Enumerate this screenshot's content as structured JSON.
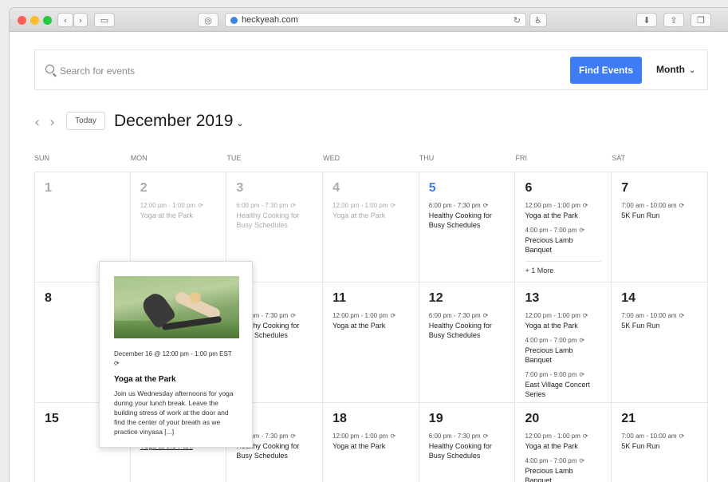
{
  "browser": {
    "url": "heckyeah.com"
  },
  "search": {
    "placeholder": "Search for events",
    "find_label": "Find Events",
    "view_label": "Month"
  },
  "nav": {
    "today_label": "Today",
    "month_label": "December 2019"
  },
  "weekdays": [
    "SUN",
    "MON",
    "TUE",
    "WED",
    "THU",
    "FRI",
    "SAT"
  ],
  "weeks": [
    [
      {
        "day": "1",
        "past": true,
        "events": []
      },
      {
        "day": "2",
        "past": true,
        "events": [
          {
            "time": "12:00 pm - 1:00 pm",
            "title": "Yoga at the Park",
            "past": true
          }
        ]
      },
      {
        "day": "3",
        "past": true,
        "events": [
          {
            "time": "6:00 pm - 7:30 pm",
            "title": "Healthy Cooking for Busy Schedules",
            "past": true
          }
        ]
      },
      {
        "day": "4",
        "past": true,
        "events": [
          {
            "time": "12:00 pm - 1:00 pm",
            "title": "Yoga at the Park",
            "past": true
          }
        ]
      },
      {
        "day": "5",
        "today": true,
        "events": [
          {
            "time": "6:00 pm - 7:30 pm",
            "title": "Healthy Cooking for Busy Schedules"
          }
        ]
      },
      {
        "day": "6",
        "events": [
          {
            "time": "12:00 pm - 1:00 pm",
            "title": "Yoga at the Park"
          },
          {
            "time": "4:00 pm - 7:00 pm",
            "title": "Precious Lamb Banquet"
          }
        ],
        "more": "+ 1 More"
      },
      {
        "day": "7",
        "events": [
          {
            "time": "7:00 am - 10:00 am",
            "title": "5K Fun Run"
          }
        ]
      }
    ],
    [
      {
        "day": "8",
        "events": []
      },
      {
        "day": "9",
        "events": []
      },
      {
        "day": "10",
        "events": [
          {
            "time": "6:00 pm - 7:30 pm",
            "title": "Healthy Cooking for Busy Schedules"
          }
        ]
      },
      {
        "day": "11",
        "events": [
          {
            "time": "12:00 pm - 1:00 pm",
            "title": "Yoga at the Park"
          }
        ]
      },
      {
        "day": "12",
        "events": [
          {
            "time": "6:00 pm - 7:30 pm",
            "title": "Healthy Cooking for Busy Schedules"
          }
        ]
      },
      {
        "day": "13",
        "events": [
          {
            "time": "12:00 pm - 1:00 pm",
            "title": "Yoga at the Park"
          },
          {
            "time": "4:00 pm - 7:00 pm",
            "title": "Precious Lamb Banquet"
          },
          {
            "time": "7:00 pm - 9:00 pm",
            "title": "East Village Concert Series"
          }
        ]
      },
      {
        "day": "14",
        "events": [
          {
            "time": "7:00 am - 10:00 am",
            "title": "5K Fun Run"
          }
        ]
      }
    ],
    [
      {
        "day": "15",
        "events": []
      },
      {
        "day": "16",
        "events": [
          {
            "time": "12:00 pm - 1:00 pm",
            "title": "Yoga at the Park",
            "link": true
          }
        ]
      },
      {
        "day": "17",
        "events": [
          {
            "time": "6:00 pm - 7:30 pm",
            "title": "Healthy Cooking for Busy Schedules"
          }
        ]
      },
      {
        "day": "18",
        "events": [
          {
            "time": "12:00 pm - 1:00 pm",
            "title": "Yoga at the Park"
          }
        ]
      },
      {
        "day": "19",
        "events": [
          {
            "time": "6:00 pm - 7:30 pm",
            "title": "Healthy Cooking for Busy Schedules"
          }
        ]
      },
      {
        "day": "20",
        "events": [
          {
            "time": "12:00 pm - 1:00 pm",
            "title": "Yoga at the Park"
          },
          {
            "time": "4:00 pm - 7:00 pm",
            "title": "Precious Lamb Banquet"
          }
        ]
      },
      {
        "day": "21",
        "events": [
          {
            "time": "7:00 am - 10:00 am",
            "title": "5K Fun Run"
          }
        ]
      }
    ]
  ],
  "popover": {
    "date": "December 16 @ 12:00 pm - 1:00 pm EST",
    "title": "Yoga at the Park",
    "description": "Join us Wednesday afternoons for yoga during your lunch break. Leave the building stress of work at the door and find the center of your breath as we practice vinyasa [...]"
  },
  "colors": {
    "accent": "#3d7cf5",
    "light_red": "#fe5f57",
    "light_yellow": "#febc2e",
    "light_green": "#28c840"
  },
  "icons": {
    "repeat": "recurring-event-icon",
    "search": "search-icon"
  }
}
